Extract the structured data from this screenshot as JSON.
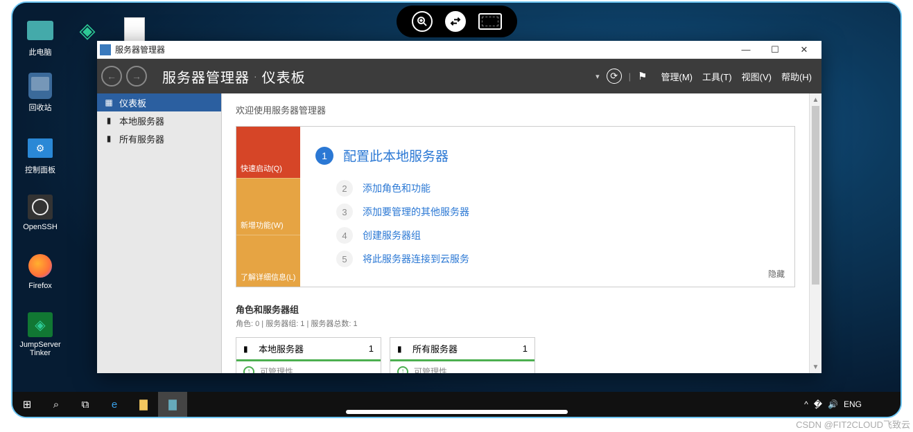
{
  "desktop_icons": {
    "computer": "此电脑",
    "recycle": "回收站",
    "cpanel": "控制面板",
    "openssh": "OpenSSH",
    "firefox": "Firefox",
    "jumpserver": "JumpServer Tinker"
  },
  "floatbar": {
    "zoom": "⊕",
    "remote": "✕",
    "keyboard": "kb"
  },
  "window": {
    "title": "服务器管理器",
    "breadcrumb": {
      "app": "服务器管理器",
      "sep": "·",
      "page": "仪表板"
    },
    "menus": {
      "manage": "管理(M)",
      "tools": "工具(T)",
      "view": "视图(V)",
      "help": "帮助(H)"
    }
  },
  "sidebar": {
    "items": [
      {
        "icon": "■",
        "label": "仪表板"
      },
      {
        "icon": "▮",
        "label": "本地服务器"
      },
      {
        "icon": "▮",
        "label": "所有服务器"
      }
    ]
  },
  "welcome": {
    "header": "欢迎使用服务器管理器",
    "left": {
      "quick": "快速启动(Q)",
      "whatsnew": "新增功能(W)",
      "learn": "了解详细信息(L)"
    },
    "steps": {
      "s1": "配置此本地服务器",
      "s2": "添加角色和功能",
      "s3": "添加要管理的其他服务器",
      "s4": "创建服务器组",
      "s5": "将此服务器连接到云服务"
    },
    "hide": "隐藏"
  },
  "groups": {
    "header": "角色和服务器组",
    "sub": "角色: 0 | 服务器组: 1 | 服务器总数: 1",
    "tile1": {
      "name": "本地服务器",
      "count": "1",
      "status": "可管理性"
    },
    "tile2": {
      "name": "所有服务器",
      "count": "1",
      "status": "可管理性"
    }
  },
  "taskbar": {
    "lang": "ENG"
  },
  "watermark": "CSDN @FIT2CLOUD飞致云"
}
